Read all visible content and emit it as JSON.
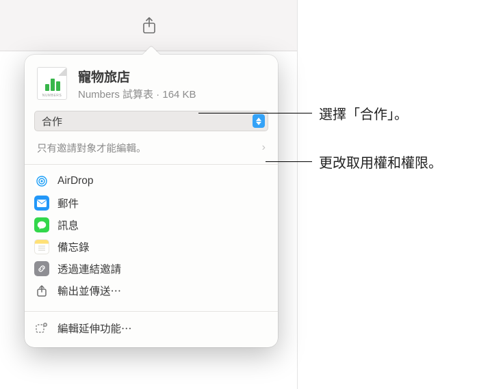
{
  "file": {
    "title": "寵物旅店",
    "subtitle": "Numbers 試算表 · 164 KB",
    "app_label": "NUMBERS"
  },
  "mode": {
    "selected": "合作"
  },
  "permissions": {
    "text": "只有邀請對象才能編輯。"
  },
  "share_options": {
    "airdrop": "AirDrop",
    "mail": "郵件",
    "messages": "訊息",
    "notes": "備忘錄",
    "link": "透過連結邀請",
    "export": "輸出並傳送⋯"
  },
  "extensions": "編輯延伸功能⋯",
  "annotations": {
    "choose_collab": "選擇「合作」。",
    "change_perm": "更改取用權和權限。"
  }
}
